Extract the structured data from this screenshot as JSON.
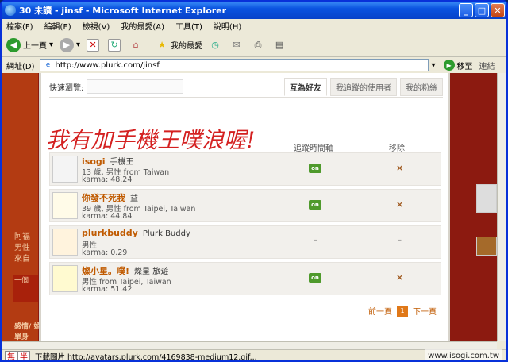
{
  "window": {
    "title": "30 未讀 - jinsf - Microsoft Internet Explorer",
    "colors": {
      "titlebar": "#0a53e0",
      "accent": "#c05a00",
      "on_badge": "#4f9a2c"
    }
  },
  "menu": [
    "檔案(F)",
    "編輯(E)",
    "檢視(V)",
    "我的最愛(A)",
    "工具(T)",
    "說明(H)"
  ],
  "toolbar": {
    "back": "上一頁",
    "favorites": "我的最愛"
  },
  "address": {
    "label": "網址(D)",
    "url": "http://www.plurk.com/jinsf",
    "go": "移至",
    "links": "連結"
  },
  "background": {
    "left_text": [
      "阿福",
      "男性",
      "來自"
    ],
    "bottom_text": "一個",
    "heading": "感情/ 婚姻狀態:",
    "heading2": "單身"
  },
  "panel": {
    "quick_browse_label": "快速瀏覽:",
    "tabs": [
      "互為好友",
      "我追蹤的使用者",
      "我的粉絲"
    ],
    "handwriting": "我有加手機王噗浪喔!",
    "columns": {
      "timeline": "追蹤時間軸",
      "remove": "移除"
    },
    "rows": [
      {
        "username": "isogi",
        "nickname": "手機王",
        "info": "13 歲, 男性 from Taiwan",
        "karma": "karma: 48.24",
        "timeline": "on",
        "remove": "×"
      },
      {
        "username": "你發不死我",
        "nickname": "益",
        "info": "39 歲, 男性 from Taipei, Taiwan",
        "karma": "karma: 44.84",
        "timeline": "on",
        "remove": "×"
      },
      {
        "username": "plurkbuddy",
        "nickname": "Plurk Buddy",
        "info": "男性",
        "karma": "karma: 0.29",
        "timeline": "–",
        "remove": "–"
      },
      {
        "username": "燦小星。噗!",
        "nickname": "燦星 旅遊",
        "info": "男性 from Taipei, Taiwan",
        "karma": "karma: 51.42",
        "timeline": "on",
        "remove": "×"
      }
    ],
    "pager": {
      "prev": "前一頁",
      "current": "1",
      "next": "下一頁"
    }
  },
  "status": {
    "ime": [
      "無",
      "半"
    ],
    "text": "下載圖片 http://avatars.plurk.com/4169838-medium12.gif...",
    "watermark": "www.isogi.com.tw"
  }
}
